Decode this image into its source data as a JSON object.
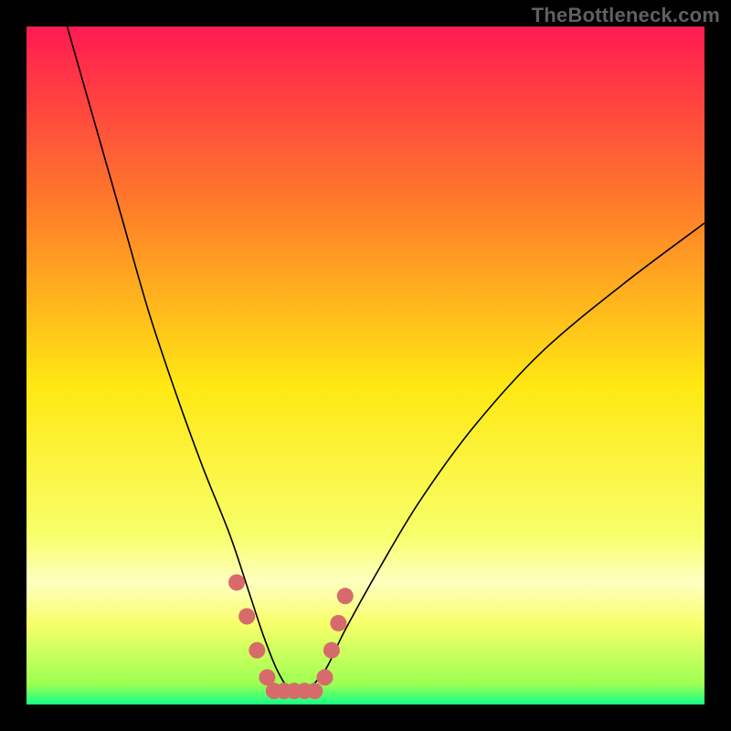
{
  "watermark": "TheBottleneck.com",
  "chart_data": {
    "type": "line",
    "title": "",
    "xlabel": "",
    "ylabel": "",
    "xlim": [
      0,
      100
    ],
    "ylim": [
      0,
      100
    ],
    "background_gradient": {
      "top": "#ff1a52",
      "mid_upper": "#ff7a2a",
      "mid": "#ffe813",
      "mid_lower": "#f8ff6a",
      "band": "#fdffc0",
      "bottom": "#13ff86"
    },
    "series": [
      {
        "name": "bottleneck-curve",
        "stroke": "#000000",
        "stroke_width": 1.6,
        "x": [
          6,
          10,
          14,
          18,
          22,
          26,
          30,
          33,
          35,
          37,
          39,
          41,
          44,
          47,
          52,
          58,
          66,
          76,
          88,
          100
        ],
        "y": [
          100,
          86,
          72,
          58,
          46,
          35,
          25,
          16,
          10,
          5,
          2,
          2,
          5,
          11,
          20,
          30,
          41,
          52,
          62,
          71
        ]
      },
      {
        "name": "highlight-dots",
        "type": "scatter",
        "color": "#d76b6b",
        "radius": 9,
        "points": [
          {
            "x": 31,
            "y": 18
          },
          {
            "x": 32.5,
            "y": 13
          },
          {
            "x": 34,
            "y": 8
          },
          {
            "x": 35.5,
            "y": 4
          },
          {
            "x": 36.5,
            "y": 2
          },
          {
            "x": 38,
            "y": 2
          },
          {
            "x": 39.5,
            "y": 2
          },
          {
            "x": 41,
            "y": 2
          },
          {
            "x": 42.5,
            "y": 2
          },
          {
            "x": 44,
            "y": 4
          },
          {
            "x": 45,
            "y": 8
          },
          {
            "x": 46,
            "y": 12
          },
          {
            "x": 47,
            "y": 16
          }
        ]
      }
    ]
  }
}
